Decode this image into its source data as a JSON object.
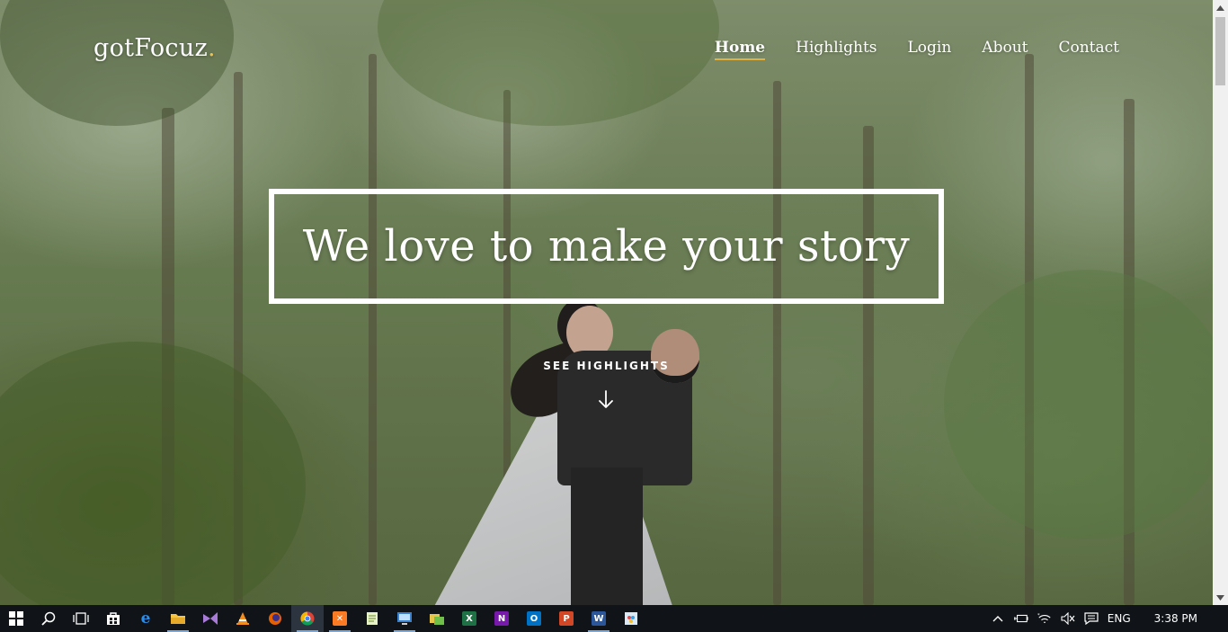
{
  "site": {
    "brand": "gotFocuz",
    "brand_dot": ".",
    "nav": [
      {
        "label": "Home",
        "active": true
      },
      {
        "label": "Highlights",
        "active": false
      },
      {
        "label": "Login",
        "active": false
      },
      {
        "label": "About",
        "active": false
      },
      {
        "label": "Contact",
        "active": false
      }
    ]
  },
  "hero": {
    "title": "We love to make your story",
    "cta": "SEE HIGHLIGHTS",
    "cta_icon": "arrow-down-icon"
  },
  "colors": {
    "nav_active_underline": "#e0b145",
    "taskbar_bg": "#101418",
    "text": "#ffffff"
  },
  "taskbar": {
    "apps": [
      {
        "name": "start-icon"
      },
      {
        "name": "search-icon"
      },
      {
        "name": "task-view-icon"
      },
      {
        "name": "store-icon"
      },
      {
        "name": "edge-icon"
      },
      {
        "name": "file-explorer-icon",
        "running": true
      },
      {
        "name": "visual-studio-icon"
      },
      {
        "name": "vlc-icon"
      },
      {
        "name": "firefox-icon"
      },
      {
        "name": "chrome-icon",
        "running": true,
        "active": true
      },
      {
        "name": "xampp-icon",
        "running": true
      },
      {
        "name": "notepad-icon"
      },
      {
        "name": "remote-desktop-icon",
        "running": true
      },
      {
        "name": "photos-icon"
      },
      {
        "name": "excel-icon",
        "letter": "X"
      },
      {
        "name": "onenote-icon",
        "letter": "N"
      },
      {
        "name": "outlook-icon",
        "letter": "O"
      },
      {
        "name": "powerpoint-icon",
        "letter": "P"
      },
      {
        "name": "word-icon",
        "letter": "W",
        "running": true
      },
      {
        "name": "paint-icon"
      }
    ],
    "tray": {
      "language": "ENG",
      "time": "3:38 PM"
    }
  }
}
